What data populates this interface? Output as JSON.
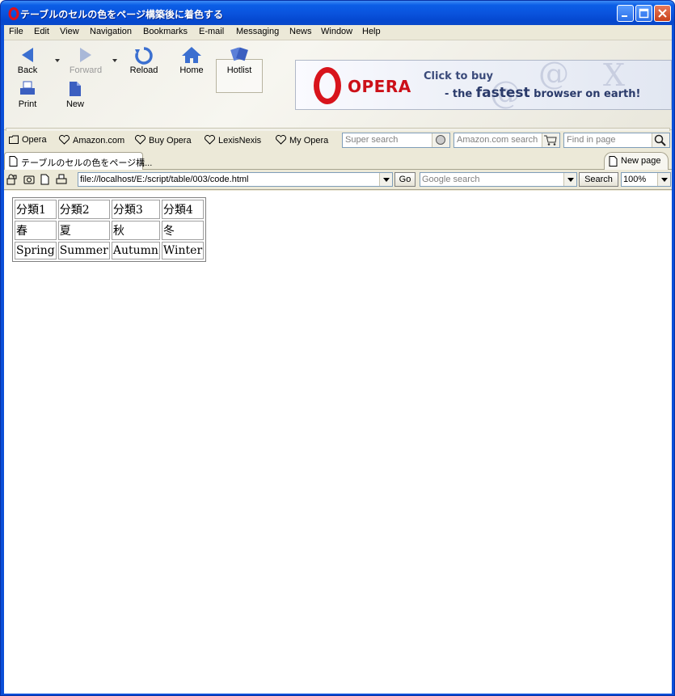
{
  "window": {
    "title": "テーブルのセルの色をページ構築後に着色する"
  },
  "menu": [
    "File",
    "Edit",
    "View",
    "Navigation",
    "Bookmarks",
    "E-mail",
    "Messaging",
    "News",
    "Window",
    "Help"
  ],
  "toolbar": {
    "back": "Back",
    "forward": "Forward",
    "reload": "Reload",
    "home": "Home",
    "hotlist": "Hotlist",
    "print": "Print",
    "new": "New"
  },
  "banner": {
    "logo": "OPERA",
    "line1": "Click to buy",
    "line2_pre": "- the ",
    "line2_bold": "fastest",
    "line2_post": " browser on earth!"
  },
  "personal_bar": {
    "items": [
      "Opera",
      "Amazon.com",
      "Buy Opera",
      "LexisNexis",
      "My Opera"
    ],
    "super_search": "Super search",
    "amazon_search": "Amazon.com search",
    "find_in_page": "Find in page"
  },
  "tabs": {
    "active": "テーブルのセルの色をページ構...",
    "new_page": "New page"
  },
  "address_bar": {
    "url": "file://localhost/E:/script/table/003/code.html",
    "go": "Go",
    "google_placeholder": "Google search",
    "search": "Search",
    "zoom": "100%"
  },
  "table": {
    "rows": [
      [
        "分類1",
        "分類2",
        "分類3",
        "分類4"
      ],
      [
        "春",
        "夏",
        "秋",
        "冬"
      ],
      [
        "Spring",
        "Summer",
        "Autumn",
        "Winter"
      ]
    ]
  }
}
